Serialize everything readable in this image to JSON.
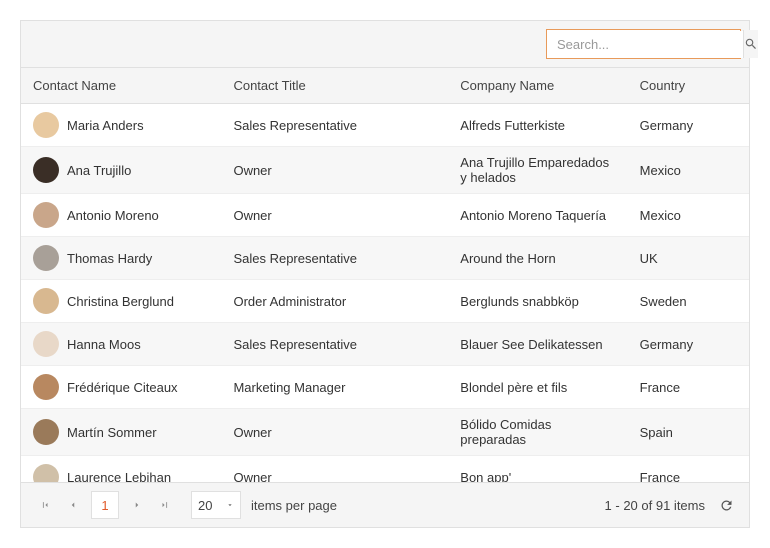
{
  "search": {
    "placeholder": "Search..."
  },
  "columns": {
    "name": "Contact Name",
    "title": "Contact Title",
    "company": "Company Name",
    "country": "Country"
  },
  "rows": [
    {
      "name": "Maria Anders",
      "title": "Sales Representative",
      "company": "Alfreds Futterkiste",
      "country": "Germany",
      "avatar": "#e8c9a0"
    },
    {
      "name": "Ana Trujillo",
      "title": "Owner",
      "company": "Ana Trujillo Emparedados y helados",
      "country": "Mexico",
      "avatar": "#3a2e26"
    },
    {
      "name": "Antonio Moreno",
      "title": "Owner",
      "company": "Antonio Moreno Taquería",
      "country": "Mexico",
      "avatar": "#c9a68a"
    },
    {
      "name": "Thomas Hardy",
      "title": "Sales Representative",
      "company": "Around the Horn",
      "country": "UK",
      "avatar": "#a8a098"
    },
    {
      "name": "Christina Berglund",
      "title": "Order Administrator",
      "company": "Berglunds snabbköp",
      "country": "Sweden",
      "avatar": "#d8b890"
    },
    {
      "name": "Hanna Moos",
      "title": "Sales Representative",
      "company": "Blauer See Delikatessen",
      "country": "Germany",
      "avatar": "#e8d8c8"
    },
    {
      "name": "Frédérique Citeaux",
      "title": "Marketing Manager",
      "company": "Blondel père et fils",
      "country": "France",
      "avatar": "#b88860"
    },
    {
      "name": "Martín Sommer",
      "title": "Owner",
      "company": "Bólido Comidas preparadas",
      "country": "Spain",
      "avatar": "#9a7a5a"
    },
    {
      "name": "Laurence Lebihan",
      "title": "Owner",
      "company": "Bon app'",
      "country": "France",
      "avatar": "#d0c0a8"
    }
  ],
  "pager": {
    "current_page": "1",
    "page_size": "20",
    "per_page_label": "items per page",
    "info": "1 - 20 of 91 items"
  }
}
